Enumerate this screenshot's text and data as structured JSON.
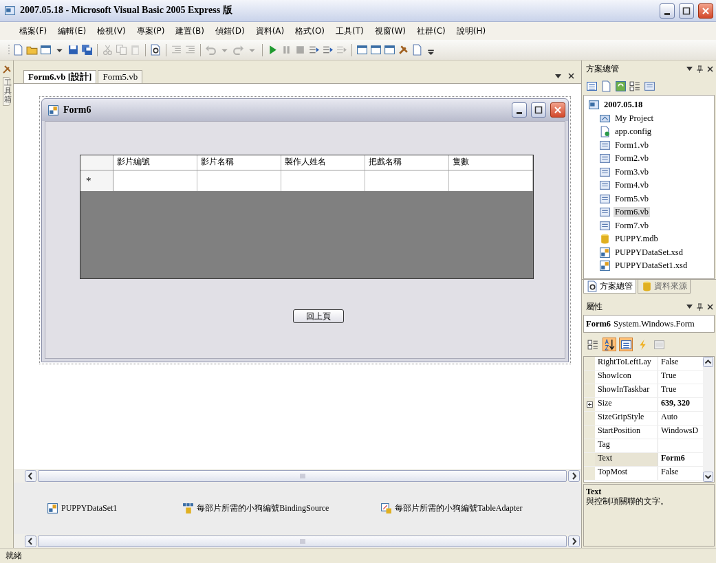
{
  "window": {
    "title": "2007.05.18 - Microsoft Visual Basic 2005 Express 版"
  },
  "menu": [
    "檔案(F)",
    "編輯(E)",
    "檢視(V)",
    "專案(P)",
    "建置(B)",
    "偵錯(D)",
    "資料(A)",
    "格式(O)",
    "工具(T)",
    "視窗(W)",
    "社群(C)",
    "說明(H)"
  ],
  "toolbar": [
    {
      "kind": "page",
      "disabled": false
    },
    {
      "kind": "folder",
      "disabled": false
    },
    {
      "kind": "window",
      "disabled": false
    },
    {
      "kind": "caret",
      "disabled": false
    },
    {
      "kind": "disk",
      "disabled": false
    },
    {
      "kind": "disks",
      "disabled": false
    },
    {
      "kind": "sep"
    },
    {
      "kind": "scissors",
      "disabled": true
    },
    {
      "kind": "copy",
      "disabled": true
    },
    {
      "kind": "clipboard",
      "disabled": true
    },
    {
      "kind": "sep"
    },
    {
      "kind": "find",
      "disabled": false
    },
    {
      "kind": "sep"
    },
    {
      "kind": "lines",
      "disabled": true
    },
    {
      "kind": "lines",
      "disabled": true
    },
    {
      "kind": "sep"
    },
    {
      "kind": "undo",
      "disabled": true
    },
    {
      "kind": "caret",
      "disabled": true
    },
    {
      "kind": "redo",
      "disabled": true
    },
    {
      "kind": "caret",
      "disabled": true
    },
    {
      "kind": "sep"
    },
    {
      "kind": "play",
      "disabled": false
    },
    {
      "kind": "pause",
      "disabled": true
    },
    {
      "kind": "stop",
      "disabled": true
    },
    {
      "kind": "step",
      "disabled": false
    },
    {
      "kind": "step",
      "disabled": false
    },
    {
      "kind": "step",
      "disabled": true
    },
    {
      "kind": "sep"
    },
    {
      "kind": "window",
      "disabled": false
    },
    {
      "kind": "window",
      "disabled": false
    },
    {
      "kind": "window",
      "disabled": false
    },
    {
      "kind": "tools",
      "disabled": false
    },
    {
      "kind": "page",
      "disabled": false
    },
    {
      "kind": "overflow",
      "disabled": false
    }
  ],
  "toolbox_tab": {
    "label": "工具箱"
  },
  "document_tabs": [
    {
      "label": "Form6.vb [設計]",
      "selected": true
    },
    {
      "label": "Form5.vb",
      "selected": false
    }
  ],
  "form": {
    "title": "Form6",
    "grid": {
      "columns": [
        "影片編號",
        "影片名稱",
        "製作人姓名",
        "把戲名稱",
        "隻數"
      ],
      "new_row_marker": "*"
    },
    "button": "回上頁"
  },
  "component_tray": [
    {
      "kind": "dataset",
      "label": "PUPPYDataSet1"
    },
    {
      "kind": "binding",
      "label": "每部片所需的小狗編號BindingSource"
    },
    {
      "kind": "adapter",
      "label": "每部片所需的小狗編號TableAdapter"
    }
  ],
  "solution_explorer": {
    "title": "方案總管",
    "tree": {
      "label": "2007.05.18",
      "kind": "project",
      "selected": false,
      "children": [
        {
          "label": "My Project",
          "kind": "myproject",
          "selected": false
        },
        {
          "label": "app.config",
          "kind": "config",
          "selected": false
        },
        {
          "label": "Form1.vb",
          "kind": "form",
          "selected": false
        },
        {
          "label": "Form2.vb",
          "kind": "form",
          "selected": false
        },
        {
          "label": "Form3.vb",
          "kind": "form",
          "selected": false
        },
        {
          "label": "Form4.vb",
          "kind": "form",
          "selected": false
        },
        {
          "label": "Form5.vb",
          "kind": "form",
          "selected": false
        },
        {
          "label": "Form6.vb",
          "kind": "form",
          "selected": true
        },
        {
          "label": "Form7.vb",
          "kind": "form",
          "selected": false
        },
        {
          "label": "PUPPY.mdb",
          "kind": "database",
          "selected": false
        },
        {
          "label": "PUPPYDataSet.xsd",
          "kind": "dataset",
          "selected": false
        },
        {
          "label": "PUPPYDataSet1.xsd",
          "kind": "dataset",
          "selected": false
        }
      ]
    }
  },
  "panel_tabs": [
    {
      "label": "方案總管",
      "selected": true
    },
    {
      "label": "資料來源",
      "selected": false
    }
  ],
  "properties": {
    "title": "屬性",
    "object_name": "Form6",
    "object_type": "System.Windows.Form",
    "toolbar": [
      {
        "kind": "categorized",
        "pressed": false
      },
      {
        "kind": "alphabetical",
        "pressed": true
      },
      {
        "kind": "properties",
        "pressed": true
      },
      {
        "kind": "events",
        "pressed": false
      },
      {
        "kind": "pages",
        "pressed": false
      }
    ],
    "rows": [
      {
        "name": "RightToLeftLay",
        "value": "False",
        "bold": false,
        "expandable": false,
        "selected": false
      },
      {
        "name": "ShowIcon",
        "value": "True",
        "bold": false,
        "expandable": false,
        "selected": false
      },
      {
        "name": "ShowInTaskbar",
        "value": "True",
        "bold": false,
        "expandable": false,
        "selected": false
      },
      {
        "name": "Size",
        "value": "639, 320",
        "bold": true,
        "expandable": true,
        "selected": false
      },
      {
        "name": "SizeGripStyle",
        "value": "Auto",
        "bold": false,
        "expandable": false,
        "selected": false
      },
      {
        "name": "StartPosition",
        "value": "WindowsD",
        "bold": false,
        "expandable": false,
        "selected": false
      },
      {
        "name": "Tag",
        "expandable": false,
        "selected": false
      },
      {
        "name": "Text",
        "value": "Form6",
        "bold": true,
        "expandable": false,
        "selected": true
      },
      {
        "name": "TopMost",
        "value": "False",
        "bold": false,
        "expandable": false,
        "selected": false
      }
    ],
    "description": {
      "title": "Text",
      "text": "與控制項關聯的文字。"
    }
  },
  "status_bar": "就緒"
}
